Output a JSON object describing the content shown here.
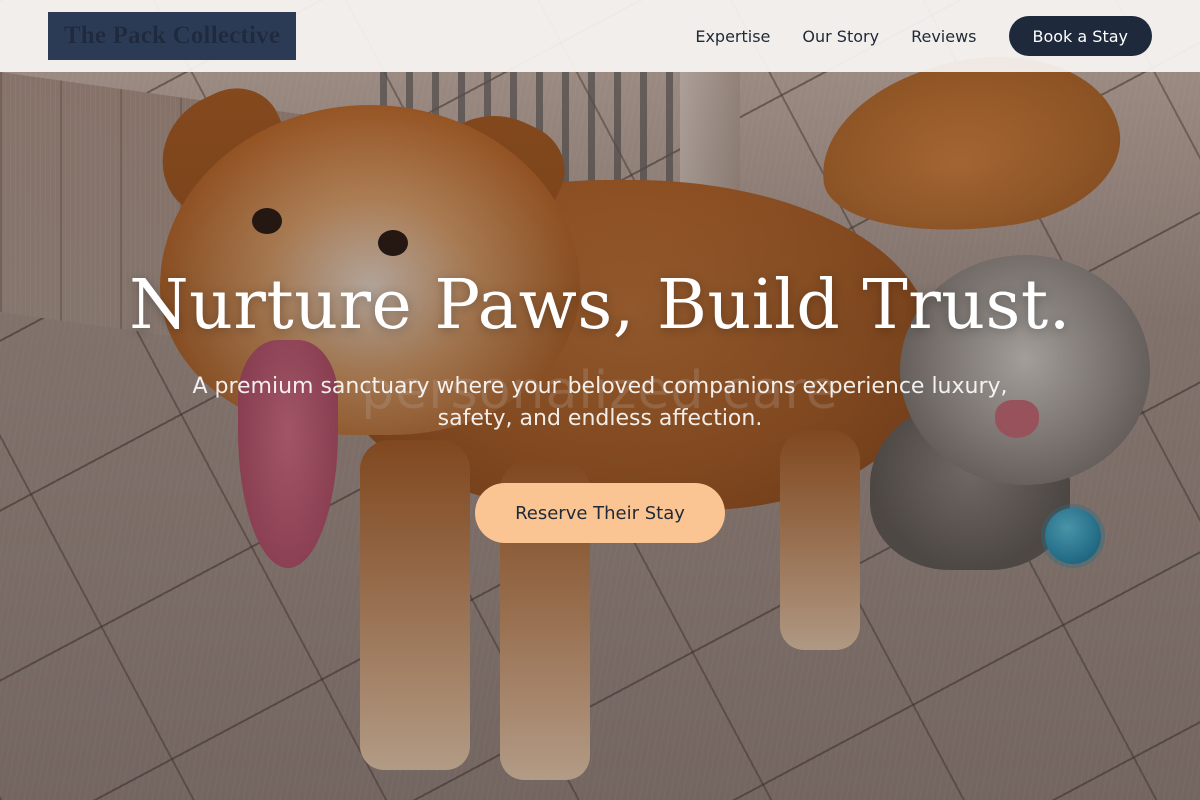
{
  "brand": {
    "name": "The Pack Collective"
  },
  "nav": {
    "links": [
      {
        "label": "Expertise"
      },
      {
        "label": "Our Story"
      },
      {
        "label": "Reviews"
      }
    ],
    "cta_label": "Book a Stay"
  },
  "hero": {
    "title": "Nurture Paws, Build Trust.",
    "subtitle": "A premium sanctuary where your beloved companions experience luxury, safety, and endless affection.",
    "ghost_text": "personalized care",
    "cta_label": "Reserve Their Stay"
  },
  "colors": {
    "header_bg": "#f8f6f4",
    "logo_bg": "#2b3a55",
    "primary_dark": "#1e293b",
    "accent_peach": "#fbc593",
    "hero_text": "#ffffff"
  },
  "icons": [
    "dog-photo-background"
  ]
}
